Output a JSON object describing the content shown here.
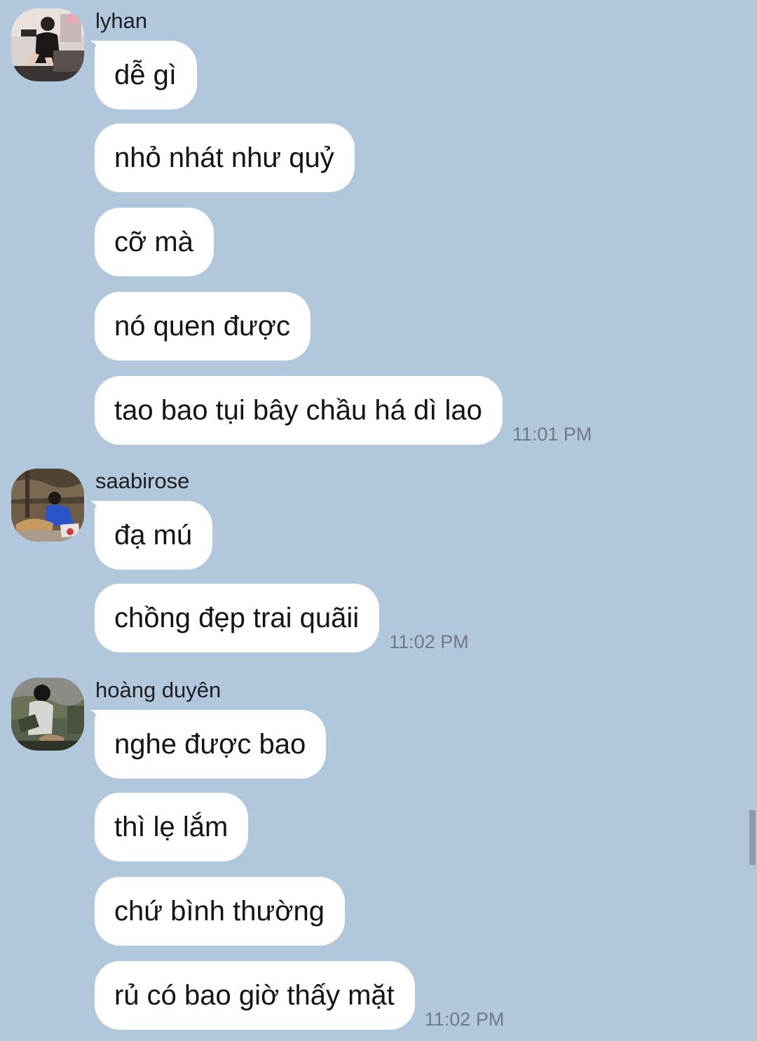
{
  "conversation": {
    "groups": [
      {
        "sender": "lyhan",
        "avatar_icon": "avatar-lyhan-photo",
        "messages": [
          "dễ gì",
          "nhỏ nhát như quỷ",
          "cỡ mà",
          "nó quen được",
          "tao bao tụi bây chầu há dì lao"
        ],
        "time": "11:01 PM"
      },
      {
        "sender": "saabirose",
        "avatar_icon": "avatar-saabirose-photo",
        "messages": [
          "đạ mú",
          "chồng đẹp trai quãii"
        ],
        "time": "11:02 PM"
      },
      {
        "sender": "hoàng duyên",
        "avatar_icon": "avatar-hoang-duyen-photo",
        "messages": [
          "nghe được bao",
          "thì lẹ lắm",
          "chứ bình thường",
          "rủ có bao giờ thấy mặt"
        ],
        "time": "11:02 PM"
      }
    ]
  },
  "colors": {
    "background": "#b1c7dc",
    "bubble": "#ffffff",
    "timestamp": "#6f7a86"
  }
}
